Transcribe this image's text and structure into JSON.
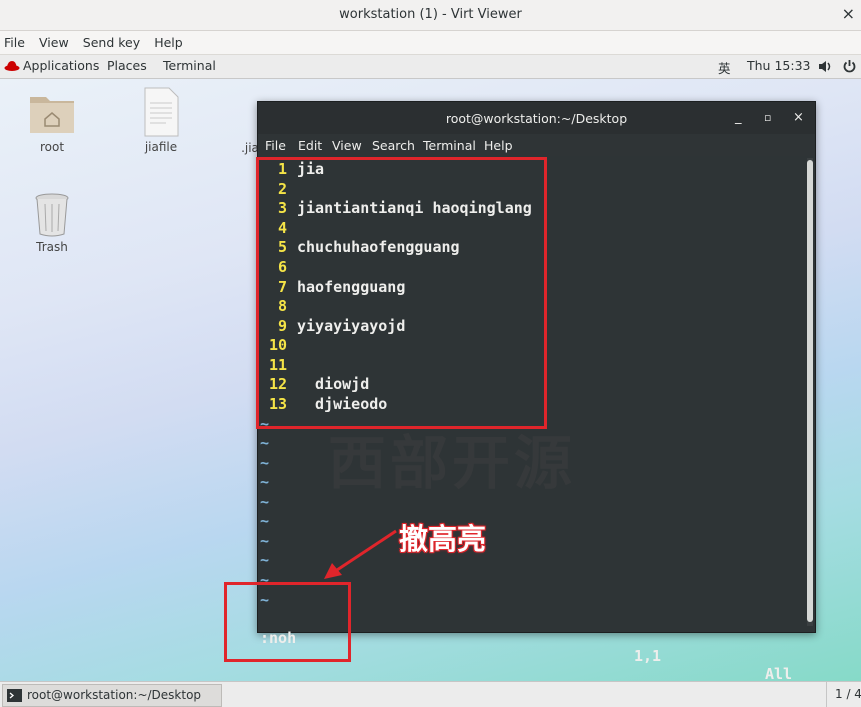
{
  "window": {
    "title": "workstation (1) - Virt Viewer",
    "close_glyph": "×"
  },
  "viewer_menu": [
    "File",
    "View",
    "Send key",
    "Help"
  ],
  "topbar": {
    "applications": "Applications",
    "places": "Places",
    "terminal": "Terminal",
    "input_method": "英",
    "clock": "Thu 15:33",
    "volume_icon": "volume-icon",
    "power_icon": "power-icon"
  },
  "desktop": {
    "icons": [
      {
        "label": "root",
        "icon": "home-folder-icon"
      },
      {
        "label": "jiafile",
        "icon": "text-file-icon"
      },
      {
        "label": ".jia",
        "icon": "file-icon"
      },
      {
        "label": "Trash",
        "icon": "trash-icon"
      }
    ]
  },
  "terminal": {
    "title": "root@workstation:~/Desktop",
    "controls": [
      "_",
      "▫",
      "×"
    ],
    "menu": [
      "File",
      "Edit",
      "View",
      "Search",
      "Terminal",
      "Help"
    ],
    "lines": [
      {
        "num": "1",
        "text": "jia"
      },
      {
        "num": "2",
        "text": ""
      },
      {
        "num": "3",
        "text": "jiantiantianqi haoqinglang"
      },
      {
        "num": "4",
        "text": ""
      },
      {
        "num": "5",
        "text": "chuchuhaofengguang"
      },
      {
        "num": "6",
        "text": ""
      },
      {
        "num": "7",
        "text": "haofengguang"
      },
      {
        "num": "8",
        "text": ""
      },
      {
        "num": "9",
        "text": "yiyayiyayojd"
      },
      {
        "num": "10",
        "text": ""
      },
      {
        "num": "11",
        "text": ""
      },
      {
        "num": "12",
        "text": "  diowjd"
      },
      {
        "num": "13",
        "text": "  djwieodo"
      }
    ],
    "tilde": "~",
    "status": {
      "command": ":noh",
      "position": "1,1",
      "scroll": "All"
    },
    "watermark": "西部开源"
  },
  "annotation": {
    "text": "撤高亮",
    "color": "#e0252b"
  },
  "taskbar": {
    "item": "root@workstation:~/Desktop",
    "workspace": "1 / 4"
  }
}
